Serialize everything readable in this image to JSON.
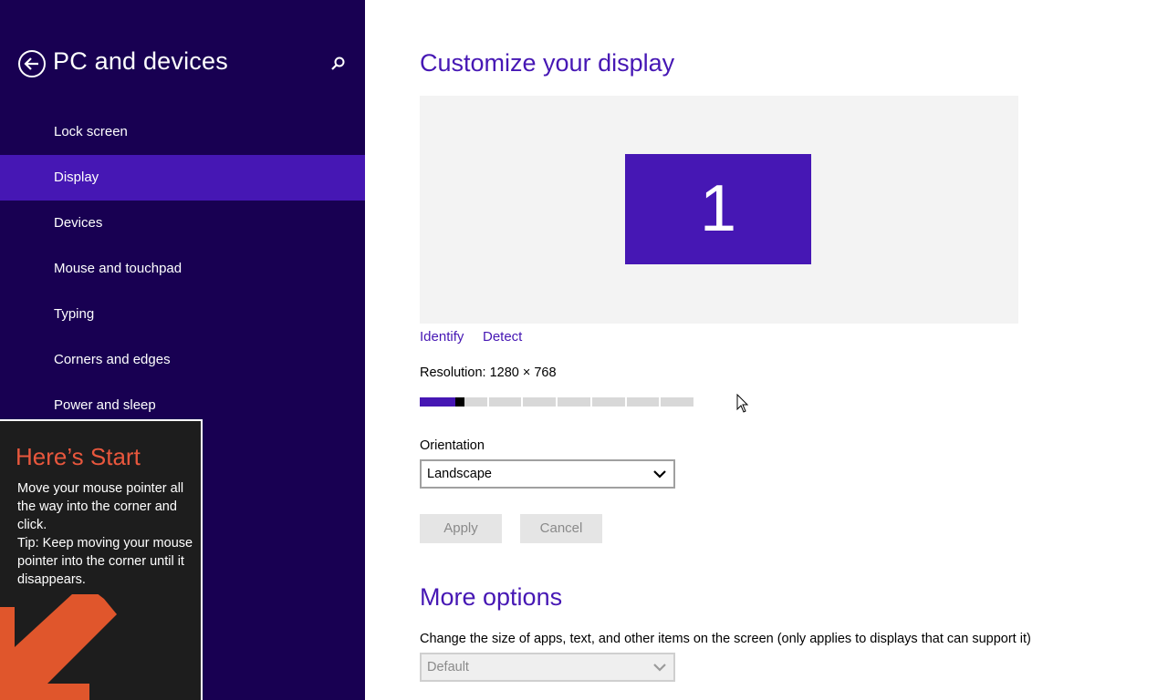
{
  "sidebar": {
    "title": "PC and devices",
    "back_icon": "back-arrow-circle-icon",
    "search_icon": "search-icon",
    "items": [
      {
        "label": "Lock screen"
      },
      {
        "label": "Display",
        "active": true
      },
      {
        "label": "Devices"
      },
      {
        "label": "Mouse and touchpad"
      },
      {
        "label": "Typing"
      },
      {
        "label": "Corners and edges"
      },
      {
        "label": "Power and sleep"
      }
    ]
  },
  "tip": {
    "title": "Here’s Start",
    "line1": "Move your mouse pointer all the way into the corner and click.",
    "line2": "Tip: Keep moving your mouse pointer into the corner until it disappears.",
    "arrow_icon": "arrow-down-left-icon"
  },
  "main": {
    "title": "Customize your display",
    "monitor_number": "1",
    "identify": "Identify",
    "detect": "Detect",
    "resolution_label": "Resolution: 1280 × 768",
    "resolution_slider": {
      "steps": 8,
      "selected_fraction": 0.13
    },
    "orientation_label": "Orientation",
    "orientation_value": "Landscape",
    "apply": "Apply",
    "cancel": "Cancel",
    "more_title": "More options",
    "size_label": "Change the size of apps, text, and other items on the screen (only applies to displays that can support it)",
    "size_value": "Default"
  },
  "colors": {
    "sidebar_bg": "#180052",
    "accent": "#4617b4",
    "tip_title": "#e8573d",
    "tip_arrow": "#e0562c"
  }
}
